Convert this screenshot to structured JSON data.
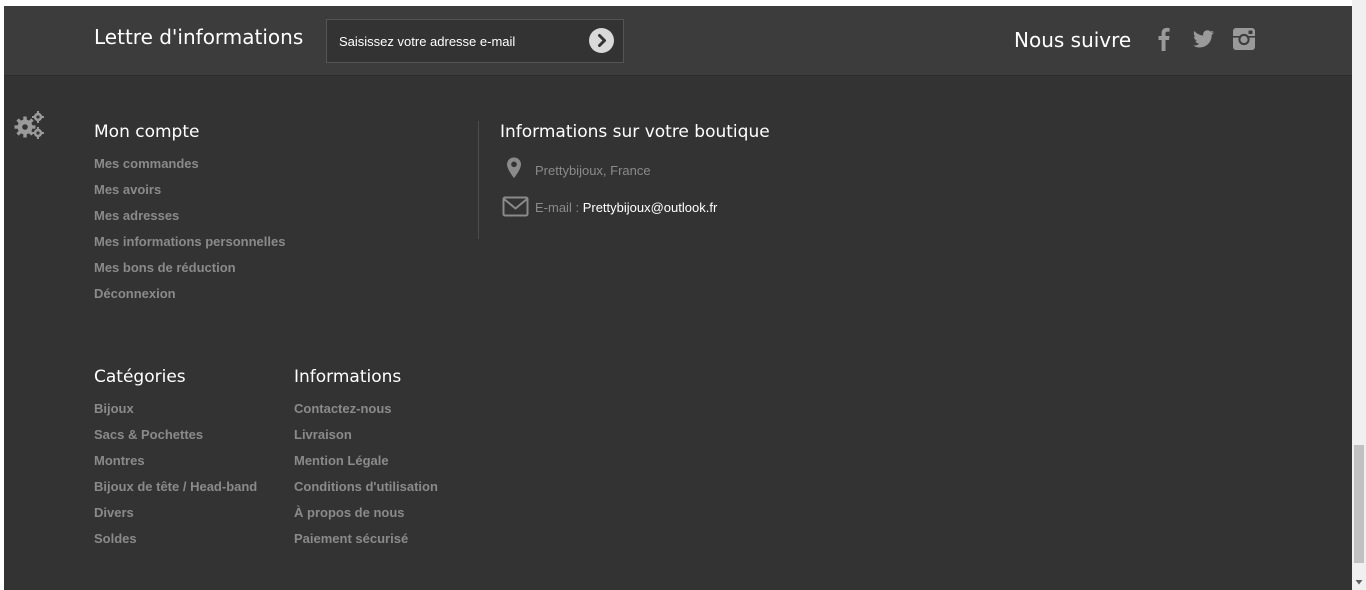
{
  "newsletter": {
    "title": "Lettre d'informations",
    "placeholder": "Saisissez votre adresse e-mail",
    "submit_icon": "chevron-right-circle-icon"
  },
  "follow": {
    "title": "Nous suivre",
    "networks": [
      "facebook-icon",
      "twitter-icon",
      "instagram-icon"
    ]
  },
  "account": {
    "title": "Mon compte",
    "links": [
      "Mes commandes",
      "Mes avoirs",
      "Mes adresses",
      "Mes informations personnelles",
      "Mes bons de réduction",
      "Déconnexion"
    ]
  },
  "store_info": {
    "title": "Informations sur votre boutique",
    "location": "Prettybijoux, France",
    "email_label": "E-mail :",
    "email_value": "Prettybijoux@outlook.fr"
  },
  "categories": {
    "title": "Catégories",
    "links": [
      "Bijoux",
      "Sacs & Pochettes",
      "Montres",
      "Bijoux de tête / Head-band",
      "Divers",
      "Soldes"
    ]
  },
  "informations": {
    "title": "Informations",
    "links": [
      "Contactez-nous",
      "Livraison",
      "Mention Légale",
      "Conditions d'utilisation",
      "À propos de nous",
      "Paiement sécurisé"
    ]
  },
  "colors": {
    "background": "#333333",
    "topbar": "#3c3c3c",
    "link": "#8a8a8a",
    "heading": "#ffffff"
  }
}
